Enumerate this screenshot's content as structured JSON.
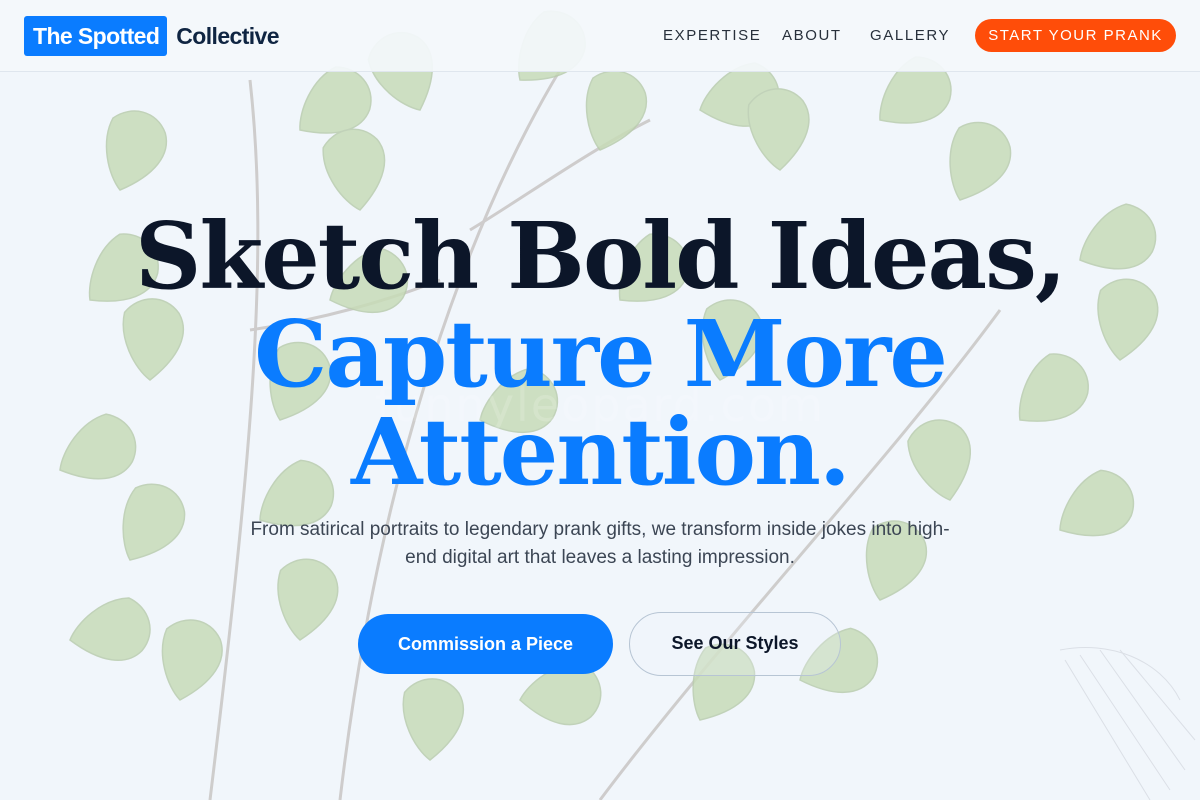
{
  "header": {
    "logo": {
      "highlight": "The Spotted",
      "word": "Collective"
    },
    "nav": [
      {
        "label": "EXPERTISE"
      },
      {
        "label": "ABOUT"
      },
      {
        "label": "GALLERY"
      }
    ],
    "cta_label": "START YOUR PRANK"
  },
  "hero": {
    "watermark": "funnyleopard.com",
    "headline_line1": "Sketch Bold Ideas,",
    "headline_line2": "Capture More",
    "headline_line3": "Attention.",
    "subtitle": "From satirical portraits to legendary prank gifts, we transform inside jokes into high-end digital art that leaves a lasting impression.",
    "primary_button": "Commission a Piece",
    "secondary_button": "See Our Styles"
  },
  "colors": {
    "accent_blue": "#0a7cff",
    "cta_orange": "#ff4d09",
    "heading_dark": "#0c1629",
    "leaf_green": "#8fb95a"
  },
  "background": {
    "illustration": "fern-branch-illustration"
  }
}
